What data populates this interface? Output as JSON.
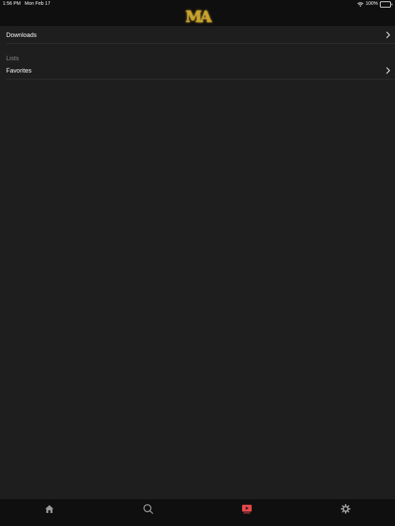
{
  "status_bar": {
    "time": "1:56 PM",
    "date": "Mon Feb 17",
    "battery": "100%"
  },
  "nav": {
    "logo_text": "MA"
  },
  "list": {
    "downloads_label": "Downloads",
    "lists_header": "Lists",
    "favorites_label": "Favorites"
  },
  "tabs": [
    {
      "icon": "home-icon",
      "selected": false
    },
    {
      "icon": "search-icon",
      "selected": false
    },
    {
      "icon": "play-video-icon",
      "selected": true
    },
    {
      "icon": "gear-icon",
      "selected": false
    }
  ],
  "colors": {
    "background": "#1e1e1e",
    "bars": "#0f0f0f",
    "accent": "#e8474b",
    "icon_inactive": "#9a9a9a",
    "logo_gold": "#c9a227",
    "section_header": "#8a8a8a"
  }
}
